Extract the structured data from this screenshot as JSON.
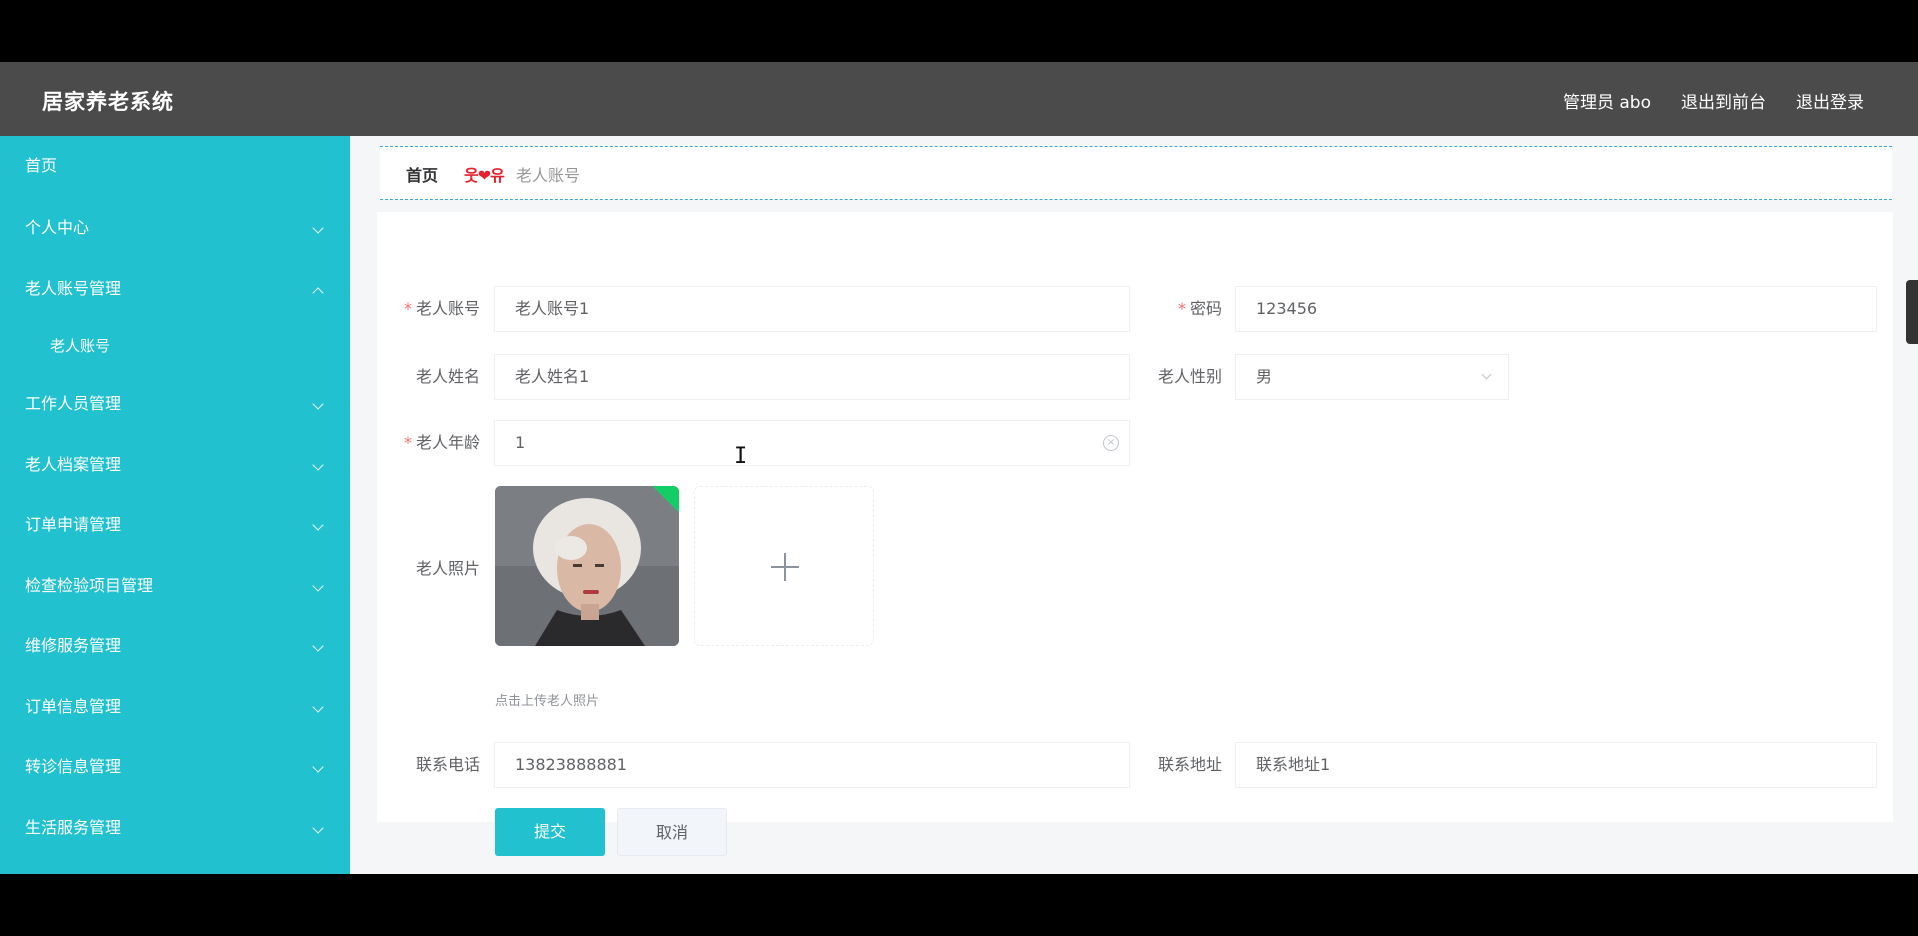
{
  "app": {
    "title": "居家养老系统"
  },
  "topnav": {
    "user": "管理员 abo",
    "front": "退出到前台",
    "logout": "退出登录"
  },
  "sidebar": {
    "items": [
      {
        "label": "首页"
      },
      {
        "label": "个人中心"
      },
      {
        "label": "老人账号管理"
      },
      {
        "label": "老人账号"
      },
      {
        "label": "工作人员管理"
      },
      {
        "label": "老人档案管理"
      },
      {
        "label": "订单申请管理"
      },
      {
        "label": "检查检验项目管理"
      },
      {
        "label": "维修服务管理"
      },
      {
        "label": "订单信息管理"
      },
      {
        "label": "转诊信息管理"
      },
      {
        "label": "生活服务管理"
      }
    ]
  },
  "breadcrumb": {
    "home": "首页",
    "sep": "웃❤유",
    "current": "老人账号"
  },
  "form": {
    "account_label": "老人账号",
    "account_value": "老人账号1",
    "password_label": "密码",
    "password_value": "123456",
    "name_label": "老人姓名",
    "name_value": "老人姓名1",
    "gender_label": "老人性别",
    "gender_value": "男",
    "age_label": "老人年龄",
    "age_value": "1",
    "photo_label": "老人照片",
    "photo_hint": "点击上传老人照片",
    "phone_label": "联系电话",
    "phone_value": "13823888881",
    "address_label": "联系地址",
    "address_value": "联系地址1",
    "submit_label": "提交",
    "cancel_label": "取消",
    "required_mark": "*"
  },
  "colors": {
    "accent": "#22c1cf",
    "header": "#4b4b4b",
    "required": "#f56c6c"
  },
  "icons": {
    "photo": "elder-portrait-icon",
    "plus": "plus-icon"
  }
}
